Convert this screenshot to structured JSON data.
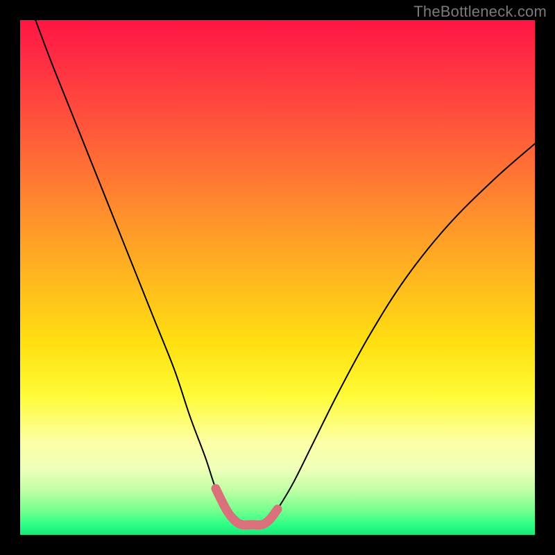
{
  "watermark": "TheBottleneck.com",
  "chart_data": {
    "type": "line",
    "title": "",
    "xlabel": "",
    "ylabel": "",
    "xlim": [
      0,
      100
    ],
    "ylim": [
      0,
      100
    ],
    "grid": false,
    "legend": false,
    "series": [
      {
        "name": "bottleneck-curve",
        "x": [
          3,
          6,
          10,
          14,
          18,
          22,
          26,
          30,
          33,
          36,
          38,
          40,
          41.5,
          43,
          45,
          47,
          48.5,
          50,
          53,
          57,
          62,
          68,
          75,
          83,
          92,
          100
        ],
        "y": [
          100,
          92,
          82,
          72,
          62,
          52,
          42,
          32,
          23,
          15,
          9,
          5,
          3,
          2,
          2,
          2,
          3,
          5,
          10,
          18,
          28,
          39,
          50,
          60,
          69,
          76
        ],
        "color": "#000000"
      },
      {
        "name": "optimal-zone-highlight",
        "x": [
          38,
          40,
          41.5,
          43,
          45,
          47,
          48.5,
          50
        ],
        "y": [
          9,
          5,
          3,
          2,
          2,
          2,
          3,
          5
        ],
        "color": "#d9707a"
      }
    ],
    "annotations": []
  },
  "colors": {
    "gradient_top": "#ff1643",
    "gradient_bottom": "#17e87b",
    "curve": "#000000",
    "highlight": "#d9707a",
    "frame": "#000000",
    "watermark": "#7a7a7a"
  }
}
